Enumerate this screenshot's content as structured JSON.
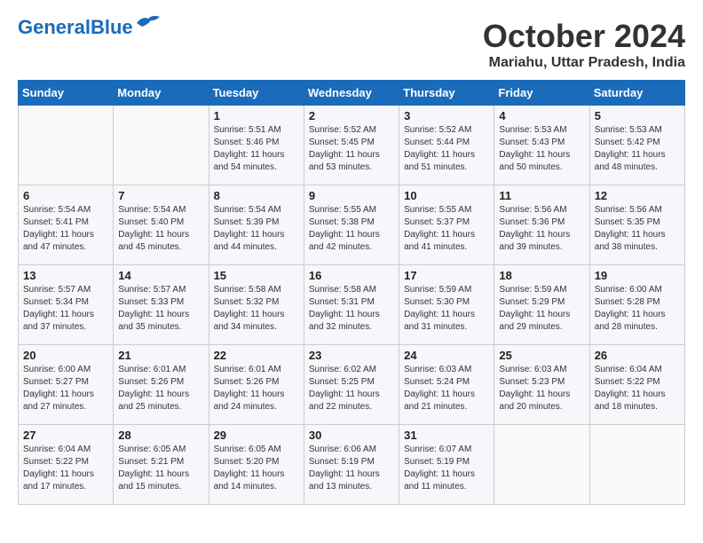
{
  "header": {
    "logo_general": "General",
    "logo_blue": "Blue",
    "month": "October 2024",
    "location": "Mariahu, Uttar Pradesh, India"
  },
  "weekdays": [
    "Sunday",
    "Monday",
    "Tuesday",
    "Wednesday",
    "Thursday",
    "Friday",
    "Saturday"
  ],
  "weeks": [
    [
      {
        "day": "",
        "info": ""
      },
      {
        "day": "",
        "info": ""
      },
      {
        "day": "1",
        "info": "Sunrise: 5:51 AM\nSunset: 5:46 PM\nDaylight: 11 hours\nand 54 minutes."
      },
      {
        "day": "2",
        "info": "Sunrise: 5:52 AM\nSunset: 5:45 PM\nDaylight: 11 hours\nand 53 minutes."
      },
      {
        "day": "3",
        "info": "Sunrise: 5:52 AM\nSunset: 5:44 PM\nDaylight: 11 hours\nand 51 minutes."
      },
      {
        "day": "4",
        "info": "Sunrise: 5:53 AM\nSunset: 5:43 PM\nDaylight: 11 hours\nand 50 minutes."
      },
      {
        "day": "5",
        "info": "Sunrise: 5:53 AM\nSunset: 5:42 PM\nDaylight: 11 hours\nand 48 minutes."
      }
    ],
    [
      {
        "day": "6",
        "info": "Sunrise: 5:54 AM\nSunset: 5:41 PM\nDaylight: 11 hours\nand 47 minutes."
      },
      {
        "day": "7",
        "info": "Sunrise: 5:54 AM\nSunset: 5:40 PM\nDaylight: 11 hours\nand 45 minutes."
      },
      {
        "day": "8",
        "info": "Sunrise: 5:54 AM\nSunset: 5:39 PM\nDaylight: 11 hours\nand 44 minutes."
      },
      {
        "day": "9",
        "info": "Sunrise: 5:55 AM\nSunset: 5:38 PM\nDaylight: 11 hours\nand 42 minutes."
      },
      {
        "day": "10",
        "info": "Sunrise: 5:55 AM\nSunset: 5:37 PM\nDaylight: 11 hours\nand 41 minutes."
      },
      {
        "day": "11",
        "info": "Sunrise: 5:56 AM\nSunset: 5:36 PM\nDaylight: 11 hours\nand 39 minutes."
      },
      {
        "day": "12",
        "info": "Sunrise: 5:56 AM\nSunset: 5:35 PM\nDaylight: 11 hours\nand 38 minutes."
      }
    ],
    [
      {
        "day": "13",
        "info": "Sunrise: 5:57 AM\nSunset: 5:34 PM\nDaylight: 11 hours\nand 37 minutes."
      },
      {
        "day": "14",
        "info": "Sunrise: 5:57 AM\nSunset: 5:33 PM\nDaylight: 11 hours\nand 35 minutes."
      },
      {
        "day": "15",
        "info": "Sunrise: 5:58 AM\nSunset: 5:32 PM\nDaylight: 11 hours\nand 34 minutes."
      },
      {
        "day": "16",
        "info": "Sunrise: 5:58 AM\nSunset: 5:31 PM\nDaylight: 11 hours\nand 32 minutes."
      },
      {
        "day": "17",
        "info": "Sunrise: 5:59 AM\nSunset: 5:30 PM\nDaylight: 11 hours\nand 31 minutes."
      },
      {
        "day": "18",
        "info": "Sunrise: 5:59 AM\nSunset: 5:29 PM\nDaylight: 11 hours\nand 29 minutes."
      },
      {
        "day": "19",
        "info": "Sunrise: 6:00 AM\nSunset: 5:28 PM\nDaylight: 11 hours\nand 28 minutes."
      }
    ],
    [
      {
        "day": "20",
        "info": "Sunrise: 6:00 AM\nSunset: 5:27 PM\nDaylight: 11 hours\nand 27 minutes."
      },
      {
        "day": "21",
        "info": "Sunrise: 6:01 AM\nSunset: 5:26 PM\nDaylight: 11 hours\nand 25 minutes."
      },
      {
        "day": "22",
        "info": "Sunrise: 6:01 AM\nSunset: 5:26 PM\nDaylight: 11 hours\nand 24 minutes."
      },
      {
        "day": "23",
        "info": "Sunrise: 6:02 AM\nSunset: 5:25 PM\nDaylight: 11 hours\nand 22 minutes."
      },
      {
        "day": "24",
        "info": "Sunrise: 6:03 AM\nSunset: 5:24 PM\nDaylight: 11 hours\nand 21 minutes."
      },
      {
        "day": "25",
        "info": "Sunrise: 6:03 AM\nSunset: 5:23 PM\nDaylight: 11 hours\nand 20 minutes."
      },
      {
        "day": "26",
        "info": "Sunrise: 6:04 AM\nSunset: 5:22 PM\nDaylight: 11 hours\nand 18 minutes."
      }
    ],
    [
      {
        "day": "27",
        "info": "Sunrise: 6:04 AM\nSunset: 5:22 PM\nDaylight: 11 hours\nand 17 minutes."
      },
      {
        "day": "28",
        "info": "Sunrise: 6:05 AM\nSunset: 5:21 PM\nDaylight: 11 hours\nand 15 minutes."
      },
      {
        "day": "29",
        "info": "Sunrise: 6:05 AM\nSunset: 5:20 PM\nDaylight: 11 hours\nand 14 minutes."
      },
      {
        "day": "30",
        "info": "Sunrise: 6:06 AM\nSunset: 5:19 PM\nDaylight: 11 hours\nand 13 minutes."
      },
      {
        "day": "31",
        "info": "Sunrise: 6:07 AM\nSunset: 5:19 PM\nDaylight: 11 hours\nand 11 minutes."
      },
      {
        "day": "",
        "info": ""
      },
      {
        "day": "",
        "info": ""
      }
    ]
  ]
}
